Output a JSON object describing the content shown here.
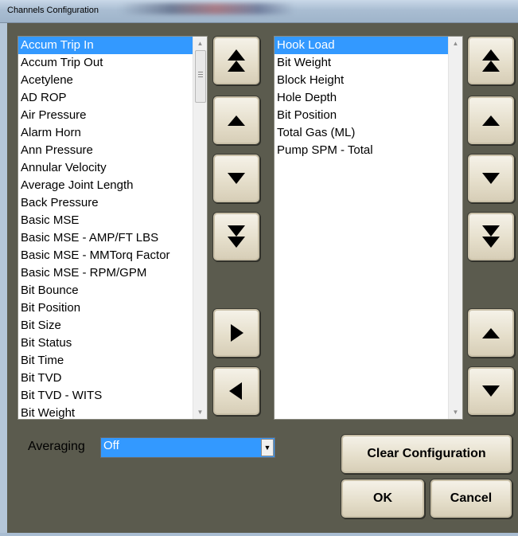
{
  "window": {
    "title": "Channels Configuration"
  },
  "available": {
    "selected_index": 0,
    "items": [
      "Accum Trip In",
      "Accum Trip Out",
      "Acetylene",
      "AD ROP",
      "Air Pressure",
      "Alarm Horn",
      "Ann Pressure",
      "Annular Velocity",
      "Average Joint Length",
      "Back Pressure",
      "Basic MSE",
      "Basic MSE - AMP/FT LBS",
      "Basic MSE - MMTorq Factor",
      "Basic MSE - RPM/GPM",
      "Bit Bounce",
      "Bit Position",
      "Bit Size",
      "Bit Status",
      "Bit Time",
      "Bit TVD",
      "Bit TVD - WITS",
      "Bit Weight"
    ]
  },
  "configured": {
    "selected_index": 0,
    "items": [
      "Hook Load",
      "Bit Weight",
      "Block Height",
      "Hole Depth",
      "Bit Position",
      "Total Gas (ML)",
      "Pump SPM - Total"
    ]
  },
  "averaging": {
    "label": "Averaging",
    "value": "Off"
  },
  "buttons": {
    "clear": "Clear Configuration",
    "ok": "OK",
    "cancel": "Cancel"
  },
  "colors": {
    "selection": "#3399ff",
    "background": "#5b5b4e",
    "button_face": "#e4ddc9"
  },
  "icons": {
    "move_top": "double-up-triangle-icon",
    "move_up": "up-triangle-icon",
    "move_down": "down-triangle-icon",
    "move_bottom": "double-down-triangle-icon",
    "add": "right-triangle-icon",
    "remove": "left-triangle-icon"
  }
}
